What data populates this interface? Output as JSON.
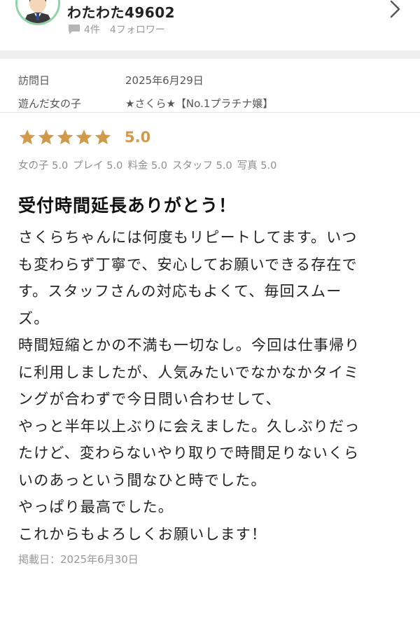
{
  "user": {
    "name": "わたわた49602",
    "review_count": "4件",
    "followers": "4フォロワー"
  },
  "visit": {
    "date_label": "訪問日",
    "date_value": "2025年6月29日",
    "girl_label": "遊んだ女の子",
    "girl_value": "★さくら★【No.1プラチナ嬢】"
  },
  "rating": {
    "stars": 5,
    "score": "5.0",
    "star_color": "#d19a4a",
    "sub_ratings": [
      "女の子 5.0",
      "プレイ 5.0",
      "料金 5.0",
      "スタッフ 5.0",
      "写真 5.0"
    ]
  },
  "review": {
    "title": "受付時間延長ありがとう！",
    "body_lines": [
      "さくらちゃんには何度もリピートしてます。いつ",
      "も変わらず丁寧で、安心してお願いできる存在で",
      "す。スタッフさんの対応もよくて、毎回スムー",
      "ズ。",
      "時間短縮とかの不満も一切なし。今回は仕事帰り",
      "に利用しましたが、人気みたいでなかなかタイミ",
      "ングが合わずで今日問い合わせして、",
      "やっと半年以上ぶりに会えました。久しぶりだっ",
      "たけど、変わらないやり取りで時間足りないくら",
      "いのあっという間なひと時でした。",
      "やっぱり最高でした。",
      "これからもよろしくお願いします！"
    ],
    "posted": "掲載日：2025年6月30日"
  }
}
